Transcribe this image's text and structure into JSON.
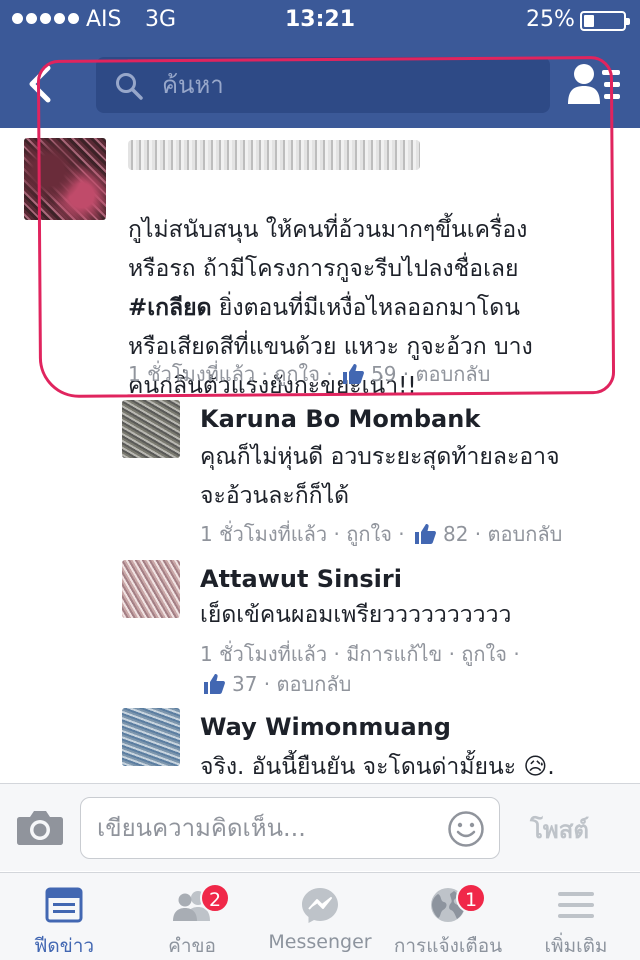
{
  "status_bar": {
    "carrier": "AIS",
    "network": "3G",
    "time": "13:21",
    "battery": "25%",
    "battery_level": 0.25
  },
  "header": {
    "search_placeholder": "ค้นหา",
    "icons": [
      "back-chevron-icon",
      "search-icon",
      "friends-list-icon"
    ]
  },
  "comments": [
    {
      "author": "",
      "text": "กูไม่สนับสนุน ให้คนที่อ้วนมากๆขึ้นเครื่อง\nหรือรถ ถ้ามีโครงการกูจะรีบไปลงชื่อเลย\n#เกลียด ยิ่งตอนที่มีเหงื่อไหลออกมาโดน\nหรือเสียดสีที่แขนด้วย แหวะ กูจะอ้วก บาง\nคนกลิ่นตัวแรงยังกะขยะเน่า!!",
      "hashtag": "#เกลียด",
      "time": "1 ชั่วโมงที่แล้ว",
      "like_label": "ถูกใจ",
      "like_count": "59",
      "reply_label": "ตอบกลับ"
    },
    {
      "author": "Karuna Bo Mombank",
      "text": "คุณก็ไม่หุ่นดี อวบระยะสุดท้ายละอาจ\nจะอ้วนละก็ก็ได้",
      "time": "1 ชั่วโมงที่แล้ว",
      "like_label": "ถูกใจ",
      "like_count": "82",
      "reply_label": "ตอบกลับ"
    },
    {
      "author": "Attawut Sinsiri",
      "text": "เย็ดเข้คนผอมเพรียวววววววววว",
      "time": "1 ชั่วโมงที่แล้ว",
      "edited_label": "มีการแก้ไข",
      "like_label": "ถูกใจ",
      "like_count": "37",
      "reply_label": "ตอบกลับ"
    },
    {
      "author": "Way Wimonmuang",
      "text": "จริง. อันนี้ยืนยัน จะโดนด่ามั้ยนะ 😥."
    }
  ],
  "composer": {
    "placeholder": "เขียนความคิดเห็น...",
    "post_label": "โพสต์"
  },
  "tabbar": {
    "tabs": [
      {
        "label": "ฟีดข่าว",
        "icon": "news-feed-icon",
        "active": true
      },
      {
        "label": "คำขอ",
        "icon": "friend-requests-icon",
        "badge": "2"
      },
      {
        "label": "Messenger",
        "icon": "messenger-icon"
      },
      {
        "label": "การแจ้งเตือน",
        "icon": "globe-icon",
        "badge": "1"
      },
      {
        "label": "เพิ่มเติม",
        "icon": "menu-icon"
      }
    ]
  },
  "colors": {
    "brand": "#3b5998",
    "annotation": "#e0245e",
    "badge": "#f02849",
    "active_tab": "#4267b2"
  }
}
